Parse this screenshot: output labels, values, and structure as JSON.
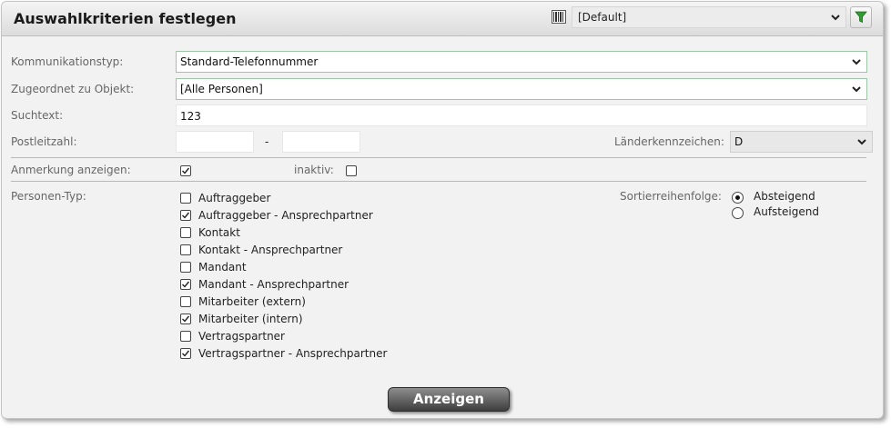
{
  "header": {
    "title": "Auswahlkriterien festlegen",
    "preset_value": "[Default]"
  },
  "form": {
    "kommunikationstyp": {
      "label": "Kommunikationstyp:",
      "value": "Standard-Telefonnummer"
    },
    "zugeordnet": {
      "label": "Zugeordnet zu Objekt:",
      "value": "[Alle Personen]"
    },
    "suchtext": {
      "label": "Suchtext:",
      "value": "123"
    },
    "postleitzahl": {
      "label": "Postleitzahl:",
      "separator": "-",
      "from": "",
      "to": ""
    },
    "laenderkennzeichen": {
      "label": "Länderkennzeichen:",
      "value": "D"
    },
    "anmerkung": {
      "label": "Anmerkung anzeigen:",
      "checked": true
    },
    "inaktiv": {
      "label": "inaktiv:",
      "checked": false
    },
    "personen_typ": {
      "label": "Personen-Typ:",
      "items": [
        {
          "label": "Auftraggeber",
          "checked": false
        },
        {
          "label": "Auftraggeber - Ansprechpartner",
          "checked": true
        },
        {
          "label": "Kontakt",
          "checked": false
        },
        {
          "label": "Kontakt - Ansprechpartner",
          "checked": false
        },
        {
          "label": "Mandant",
          "checked": false
        },
        {
          "label": "Mandant - Ansprechpartner",
          "checked": true
        },
        {
          "label": "Mitarbeiter (extern)",
          "checked": false
        },
        {
          "label": "Mitarbeiter (intern)",
          "checked": true
        },
        {
          "label": "Vertragspartner",
          "checked": false
        },
        {
          "label": "Vertragspartner - Ansprechpartner",
          "checked": true
        }
      ]
    },
    "sortierung": {
      "label": "Sortierreihenfolge:",
      "options": [
        {
          "label": "Absteigend",
          "selected": true
        },
        {
          "label": "Aufsteigend",
          "selected": false
        }
      ]
    }
  },
  "submit_label": "Anzeigen",
  "colors": {
    "accent_border": "#9cc6a5",
    "filter_icon": "#2e9e2e"
  }
}
